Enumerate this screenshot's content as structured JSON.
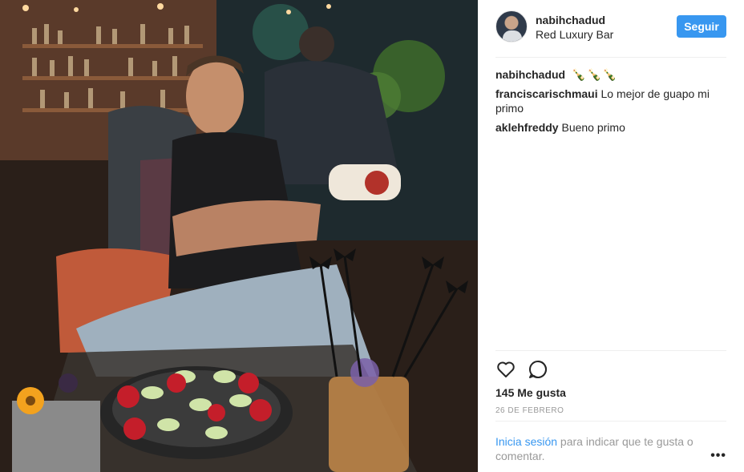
{
  "post": {
    "username": "nabihchadud",
    "location": "Red Luxury Bar",
    "follow_label": "Seguir"
  },
  "comments": [
    {
      "user": "nabihchadud",
      "text": "🍾🍾🍾"
    },
    {
      "user": "franciscarischmaui",
      "text": "Lo mejor de guapo mi primo"
    },
    {
      "user": "aklehfreddy",
      "text": "Bueno primo"
    }
  ],
  "stats": {
    "likes": "145 Me gusta",
    "date": "26 DE FEBRERO"
  },
  "login": {
    "link": "Inicia sesión",
    "text": " para indicar que te gusta o comentar."
  },
  "more_label": "•••",
  "icons": {
    "like": "heart-icon",
    "comment": "speech-bubble-icon",
    "more": "ellipsis-icon"
  },
  "colors": {
    "accent": "#3897f0",
    "text": "#262626",
    "muted": "#999999"
  }
}
